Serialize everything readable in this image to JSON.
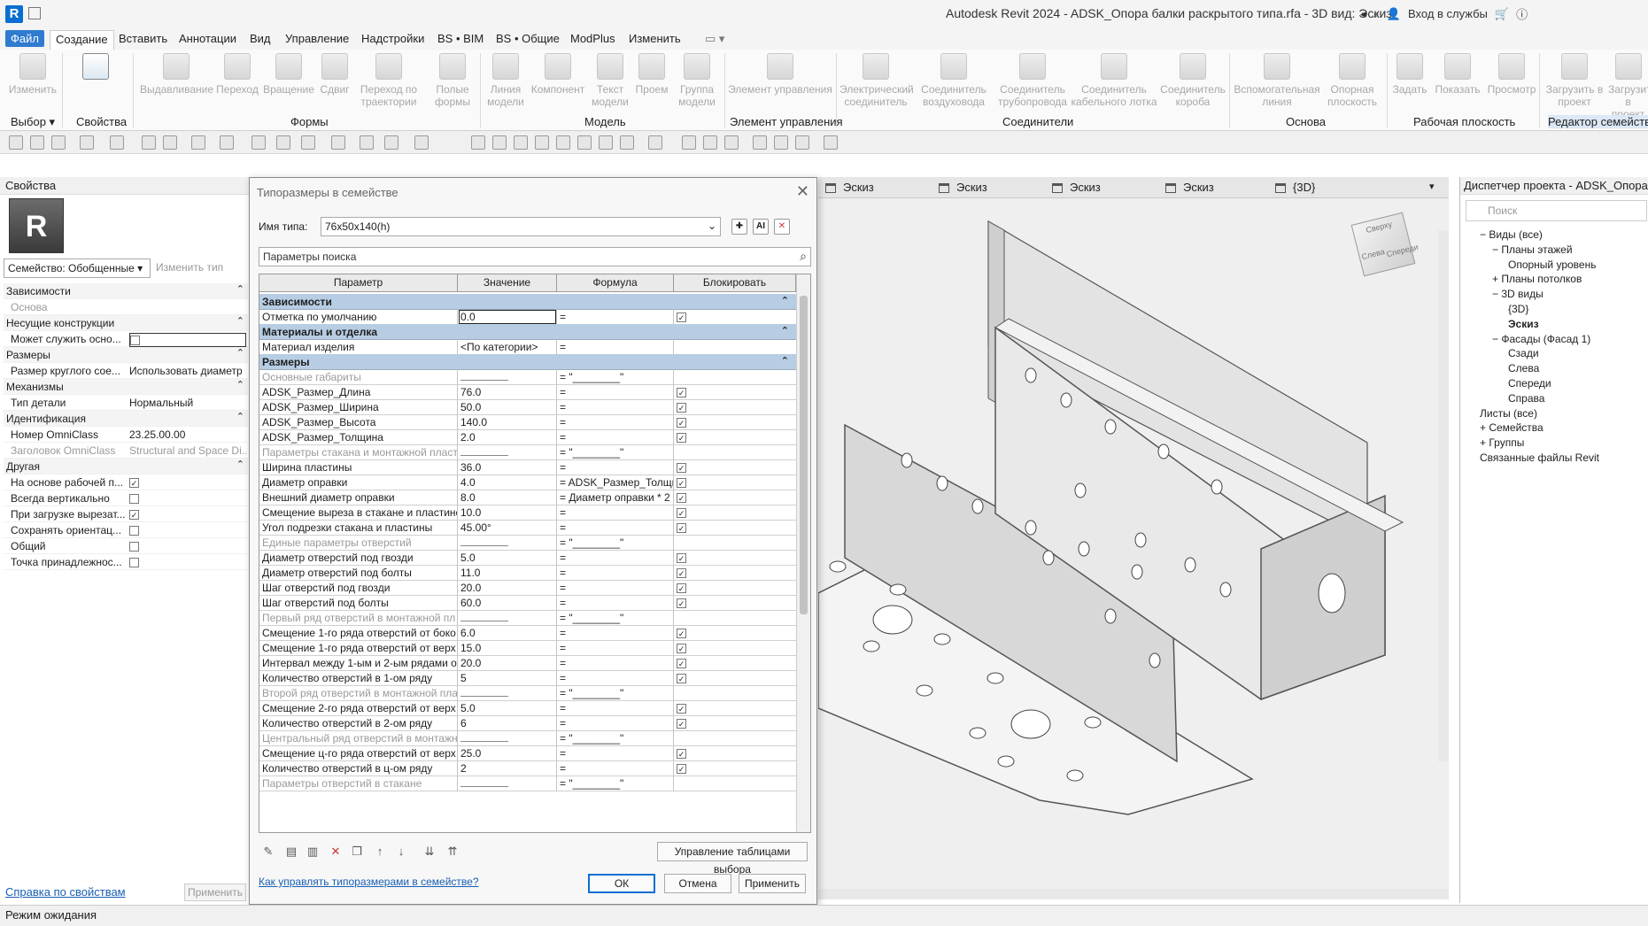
{
  "window": {
    "title": "Autodesk Revit 2024 - ADSK_Опора балки раскрытого типа.rfa - 3D вид: Эскиз",
    "signin": "Вход в службы",
    "logo": "R"
  },
  "menu": [
    "Файл",
    "Создание",
    "Вставить",
    "Аннотации",
    "Вид",
    "Управление",
    "Надстройки",
    "BS • BIM",
    "BS • Общие",
    "ModPlus",
    "Изменить"
  ],
  "ribbon": {
    "buttons": [
      "Изменить",
      "Выдавливание",
      "Переход",
      "Вращение",
      "Сдвиг",
      "Переход по траектории",
      "Полые формы",
      "Линия модели",
      "Компонент",
      "Текст модели",
      "Проем",
      "Группа модели",
      "Элемент управления",
      "Электрический соединитель",
      "Соединитель воздуховода",
      "Соединитель трубопровода",
      "Соединитель кабельного лотка",
      "Соединитель короба",
      "Вспомогательная линия",
      "Опорная плоскость",
      "Задать",
      "Показать",
      "Просмотр",
      "Загрузить в проект",
      "Загрузить в проект"
    ],
    "panels": [
      "Выбор",
      "Свойства",
      "Формы",
      "Модель",
      "Элемент управления",
      "Соединители",
      "Основа",
      "Рабочая плоскость",
      "Редактор семейств"
    ]
  },
  "properties": {
    "header": "Свойства",
    "icon_letter": "R",
    "family_selector": "Семейство: Обобщенные",
    "edit_type": "Изменить тип",
    "rows": [
      {
        "name": "Зависимости",
        "cat": true
      },
      {
        "name": "Основа",
        "value": "",
        "dim": true
      },
      {
        "name": "Несущие конструкции",
        "cat": true
      },
      {
        "name": "Может служить осно...",
        "value": "",
        "check": false,
        "boxed": true
      },
      {
        "name": "Размеры",
        "cat": true
      },
      {
        "name": "Размер круглого сое...",
        "value": "Использовать диаметр"
      },
      {
        "name": "Механизмы",
        "cat": true
      },
      {
        "name": "Тип детали",
        "value": "Нормальный"
      },
      {
        "name": "Идентификация",
        "cat": true
      },
      {
        "name": "Номер OmniClass",
        "value": "23.25.00.00"
      },
      {
        "name": "Заголовок OmniClass",
        "value": "Structural and Space Di...",
        "dim": true
      },
      {
        "name": "Другая",
        "cat": true
      },
      {
        "name": "На основе рабочей п...",
        "check": true
      },
      {
        "name": "Всегда вертикально",
        "check": false
      },
      {
        "name": "При загрузке вырезат...",
        "check": true
      },
      {
        "name": "Сохранять ориентац...",
        "check": false
      },
      {
        "name": "Общий",
        "check": false
      },
      {
        "name": "Точка принадлежнос...",
        "check": false
      }
    ],
    "help_link": "Справка по свойствам",
    "apply": "Применить"
  },
  "view_tabs": [
    "Эскиз",
    "Эскиз",
    "Эскиз",
    "Эскиз",
    "{3D}"
  ],
  "viewcube": {
    "top": "Сверху",
    "left": "Слева",
    "right": "Спереди"
  },
  "project_browser": {
    "header": "Диспетчер проекта - ADSK_Опора бал",
    "search": "Поиск",
    "nodes": [
      {
        "label": "Виды (все)",
        "exp": "−"
      },
      {
        "label": "Планы этажей",
        "exp": "−"
      },
      {
        "label": "Опорный уровень",
        "exp": ""
      },
      {
        "label": "Планы потолков",
        "exp": "+"
      },
      {
        "label": "3D виды",
        "exp": "−"
      },
      {
        "label": "{3D}",
        "exp": ""
      },
      {
        "label": "Эскиз",
        "exp": "",
        "bold": true
      },
      {
        "label": "Фасады (Фасад 1)",
        "exp": "−"
      },
      {
        "label": "Сзади",
        "exp": ""
      },
      {
        "label": "Слева",
        "exp": ""
      },
      {
        "label": "Спереди",
        "exp": ""
      },
      {
        "label": "Справа",
        "exp": ""
      },
      {
        "label": "Листы (все)",
        "exp": ""
      },
      {
        "label": "Семейства",
        "exp": "+"
      },
      {
        "label": "Группы",
        "exp": "+"
      },
      {
        "label": "Связанные файлы Revit",
        "exp": ""
      }
    ]
  },
  "dialog": {
    "title": "Типоразмеры в семействе",
    "type_name_label": "Имя типа:",
    "type_name": "76x50x140(h)",
    "search_placeholder": "Параметры поиска",
    "columns": [
      "Параметр",
      "Значение",
      "Формула",
      "Блокировать"
    ],
    "rows": [
      {
        "p": "Зависимости",
        "grp": true
      },
      {
        "p": "Отметка по умолчанию",
        "v": "0.0",
        "f": "=",
        "lock": true,
        "sel": true
      },
      {
        "p": "Материалы и отделка",
        "grp": true
      },
      {
        "p": "Материал изделия",
        "v": "<По категории>",
        "f": "="
      },
      {
        "p": "Размеры",
        "grp": true
      },
      {
        "p": "Основные габариты",
        "dim": true,
        "line": true,
        "f": "= \"________\""
      },
      {
        "p": "ADSK_Размер_Длина",
        "v": "76.0",
        "f": "=",
        "lock": true
      },
      {
        "p": "ADSK_Размер_Ширина",
        "v": "50.0",
        "f": "=",
        "lock": true
      },
      {
        "p": "ADSK_Размер_Высота",
        "v": "140.0",
        "f": "=",
        "lock": true
      },
      {
        "p": "ADSK_Размер_Толщина",
        "v": "2.0",
        "f": "=",
        "lock": true
      },
      {
        "p": "Параметры стакана и монтажной пласт",
        "dim": true,
        "line": true,
        "f": "= \"________\""
      },
      {
        "p": "Ширина пластины",
        "v": "36.0",
        "f": "=",
        "lock": true
      },
      {
        "p": "Диаметр оправки",
        "v": "4.0",
        "f": "= ADSK_Размер_Толщи",
        "lock": true
      },
      {
        "p": "Внешний диаметр оправки",
        "v": "8.0",
        "f": "= Диаметр оправки * 2",
        "lock": true
      },
      {
        "p": "Смещение выреза в стакане и пластине",
        "v": "10.0",
        "f": "=",
        "lock": true
      },
      {
        "p": "Угол подрезки стакана и пластины",
        "v": "45.00°",
        "f": "=",
        "lock": true
      },
      {
        "p": "Единые параметры отверстий",
        "dim": true,
        "line": true,
        "f": "= \"________\""
      },
      {
        "p": "Диаметр отверстий под гвозди",
        "v": "5.0",
        "f": "=",
        "lock": true
      },
      {
        "p": "Диаметр отверстий под болты",
        "v": "11.0",
        "f": "=",
        "lock": true
      },
      {
        "p": "Шаг отверстий под гвозди",
        "v": "20.0",
        "f": "=",
        "lock": true
      },
      {
        "p": "Шаг отверстий под болты",
        "v": "60.0",
        "f": "=",
        "lock": true
      },
      {
        "p": "Первый ряд отверстий в монтажной пл",
        "dim": true,
        "line": true,
        "f": "= \"________\""
      },
      {
        "p": "Смещение 1-го ряда отверстий от боко",
        "v": "6.0",
        "f": "=",
        "lock": true
      },
      {
        "p": "Смещение 1-го ряда отверстий от верх",
        "v": "15.0",
        "f": "=",
        "lock": true
      },
      {
        "p": "Интервал между 1-ым и 2-ым рядами о",
        "v": "20.0",
        "f": "=",
        "lock": true
      },
      {
        "p": "Количество отверстий в 1-ом ряду",
        "v": "5",
        "f": "=",
        "lock": true
      },
      {
        "p": "Второй ряд отверстий в монтажной пла",
        "dim": true,
        "line": true,
        "f": "= \"________\""
      },
      {
        "p": "Смещение 2-го ряда отверстий от верх",
        "v": "5.0",
        "f": "=",
        "lock": true
      },
      {
        "p": "Количество отверстий в 2-ом ряду",
        "v": "6",
        "f": "=",
        "lock": true
      },
      {
        "p": "Центральный ряд отверстий в монтажн",
        "dim": true,
        "line": true,
        "f": "= \"________\""
      },
      {
        "p": "Смещение ц-го ряда отверстий от верх",
        "v": "25.0",
        "f": "=",
        "lock": true
      },
      {
        "p": "Количество отверстий в ц-ом ряду",
        "v": "2",
        "f": "=",
        "lock": true
      },
      {
        "p": "Параметры отверстий в стакане",
        "dim": true,
        "line": true,
        "f": "= \"________\""
      }
    ],
    "manage_lookup": "Управление таблицами выбора",
    "help_link": "Как управлять типоразмерами в семействе?",
    "ok": "ОК",
    "cancel": "Отмена",
    "apply": "Применить"
  },
  "status": "Режим ожидания",
  "colors": {
    "accent": "#2e7bcf",
    "group_row": "#b7cde3",
    "link": "#1a5fb4"
  }
}
